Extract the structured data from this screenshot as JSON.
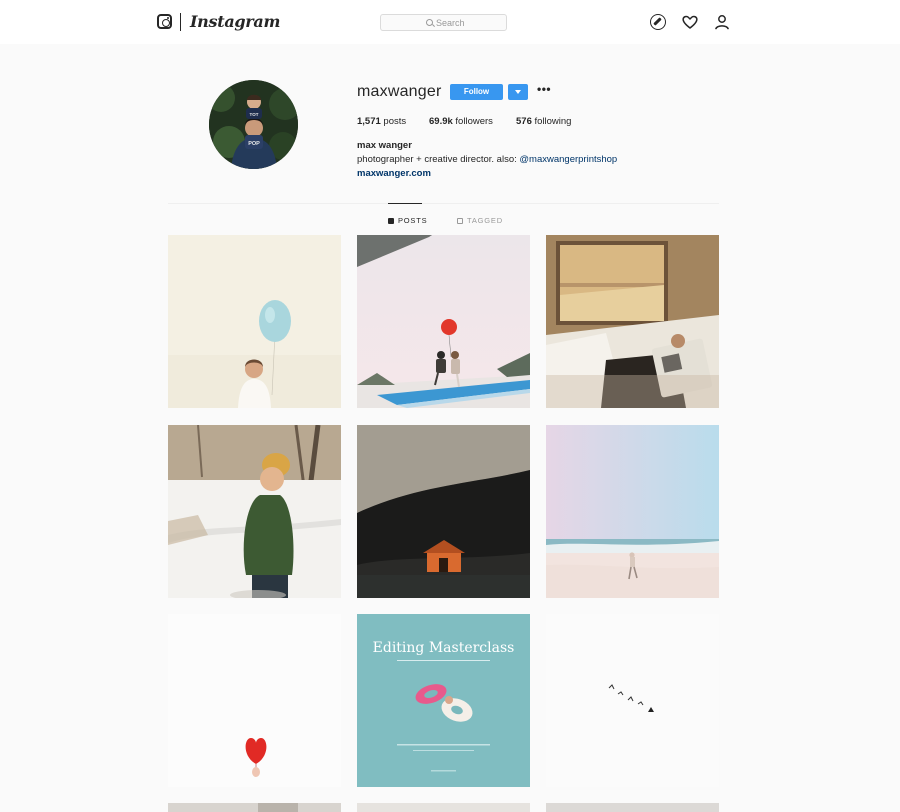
{
  "nav": {
    "brand": "Instagram",
    "search": {
      "placeholder": "Search",
      "value": ""
    },
    "icons": [
      "instagram-glyph-icon",
      "compass-icon",
      "heart-icon",
      "user-icon",
      "search-icon"
    ]
  },
  "profile": {
    "username": "maxwanger",
    "follow_label": "Follow",
    "more_label": "•••",
    "stats": [
      {
        "count": "1,571",
        "label": "posts"
      },
      {
        "count": "69.9k",
        "label": "followers"
      },
      {
        "count": "576",
        "label": "following"
      }
    ],
    "full_name": "max wanger",
    "bio_prefix": "photographer + creative director. also: ",
    "bio_mention": "@maxwangerprintshop",
    "website": "maxwanger.com",
    "avatar_shirt_top": "TOT",
    "avatar_shirt_bottom": "POP"
  },
  "tabs": [
    {
      "label": "POSTS",
      "icon": "grid-icon",
      "active": true
    },
    {
      "label": "TAGGED",
      "icon": "tag-icon",
      "active": false
    }
  ],
  "posts": {
    "editing_title": "Editing Masterclass"
  },
  "colors": {
    "accent": "#3897f0",
    "link": "#003569",
    "text": "#262626",
    "muted": "#999999",
    "background": "#fafafa"
  }
}
